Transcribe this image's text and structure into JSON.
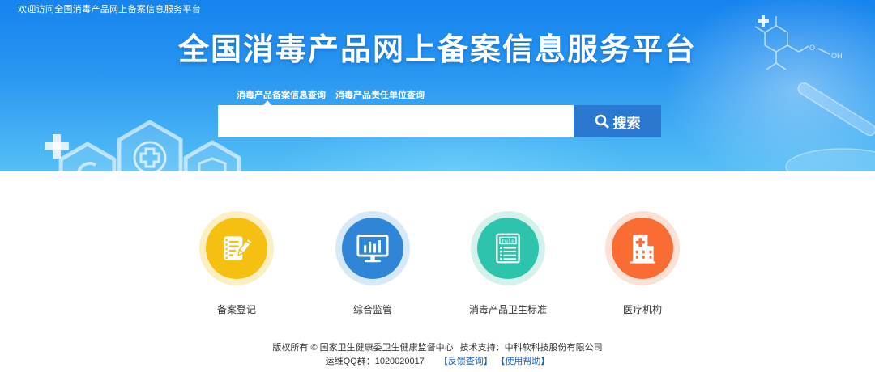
{
  "header": {
    "welcome": "欢迎访问全国消毒产品网上备案信息服务平台",
    "title": "全国消毒产品网上备案信息服务平台"
  },
  "search": {
    "tabs": [
      {
        "label": "消毒产品备案信息查询",
        "active": true
      },
      {
        "label": "消毒产品责任单位查询",
        "active": false
      }
    ],
    "value": "",
    "button_label": "搜索",
    "button_icon": "search-icon"
  },
  "features": [
    {
      "label": "备案登记",
      "icon": "notepad-pencil-icon",
      "color": "#f6c012",
      "ring_color": "#fcefc2"
    },
    {
      "label": "综合监管",
      "icon": "monitor-bar-chart-icon",
      "color": "#2f86d6",
      "ring_color": "#d6e9f8"
    },
    {
      "label": "消毒产品卫生标准",
      "icon": "rule-document-icon",
      "icon_text": "rule",
      "color": "#2ec3ad",
      "ring_color": "#d4f2ec"
    },
    {
      "label": "医疗机构",
      "icon": "hospital-icon",
      "color": "#f96c34",
      "ring_color": "#fde1d4"
    }
  ],
  "footer": {
    "copyright": "版权所有 © 国家卫生健康委卫生健康监督中心",
    "support": "技术支持：中科软科技股份有限公司",
    "qq_group": "运维QQ群：1020020017",
    "links": [
      {
        "label": "【反馈查询】"
      },
      {
        "label": "【使用帮助】"
      }
    ]
  },
  "decoration": {
    "chem_labels": [
      "O",
      "OH"
    ]
  },
  "colors": {
    "banner_top": "#1683ee",
    "banner_bottom": "#55bff6",
    "search_button": "#2a78cf",
    "link": "#1a5fb4",
    "text": "#333333"
  }
}
